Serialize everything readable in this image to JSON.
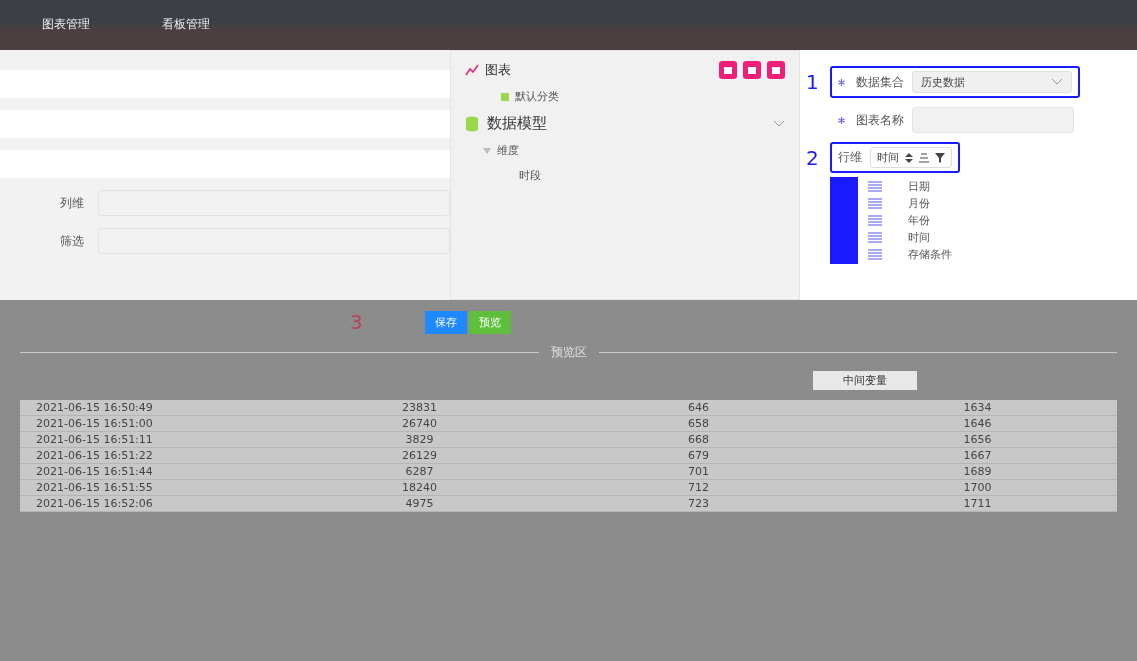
{
  "nav": {
    "tabs": [
      {
        "label": "图表管理"
      },
      {
        "label": "看板管理"
      }
    ]
  },
  "left_form": {
    "fields": [
      {
        "label": "列维"
      },
      {
        "label": "筛选"
      }
    ]
  },
  "chart_panel": {
    "title": "图表",
    "categories": [
      {
        "label": "默认分类"
      }
    ],
    "model": {
      "title": "数据模型",
      "expanded": true,
      "groups": [
        {
          "label": "维度",
          "expanded": true,
          "children": [
            {
              "label": "时段"
            }
          ]
        }
      ]
    }
  },
  "config": {
    "dataset": {
      "step": "1",
      "label": "数据集合",
      "required": true,
      "value": "历史数据"
    },
    "name": {
      "label": "图表名称",
      "required": true
    },
    "row_dim": {
      "step": "2",
      "label": "行维",
      "chip": "时间"
    },
    "fields": [
      {
        "label": "日期"
      },
      {
        "label": "月份"
      },
      {
        "label": "年份"
      },
      {
        "label": "时间"
      },
      {
        "label": "存储条件"
      }
    ]
  },
  "actions": {
    "step": "3",
    "buttons": [
      {
        "label": "保存",
        "kind": "primary"
      },
      {
        "label": "预览",
        "kind": "success"
      }
    ]
  },
  "preview": {
    "title": "预览区",
    "variable_label": "中间变量",
    "rows": [
      [
        "2021-06-15 16:50:49",
        "23831",
        "646",
        "1634"
      ],
      [
        "2021-06-15 16:51:00",
        "26740",
        "658",
        "1646"
      ],
      [
        "2021-06-15 16:51:11",
        "3829",
        "668",
        "1656"
      ],
      [
        "2021-06-15 16:51:22",
        "26129",
        "679",
        "1667"
      ],
      [
        "2021-06-15 16:51:44",
        "6287",
        "701",
        "1689"
      ],
      [
        "2021-06-15 16:51:55",
        "18240",
        "712",
        "1700"
      ],
      [
        "2021-06-15 16:52:06",
        "4975",
        "723",
        "1711"
      ]
    ]
  }
}
